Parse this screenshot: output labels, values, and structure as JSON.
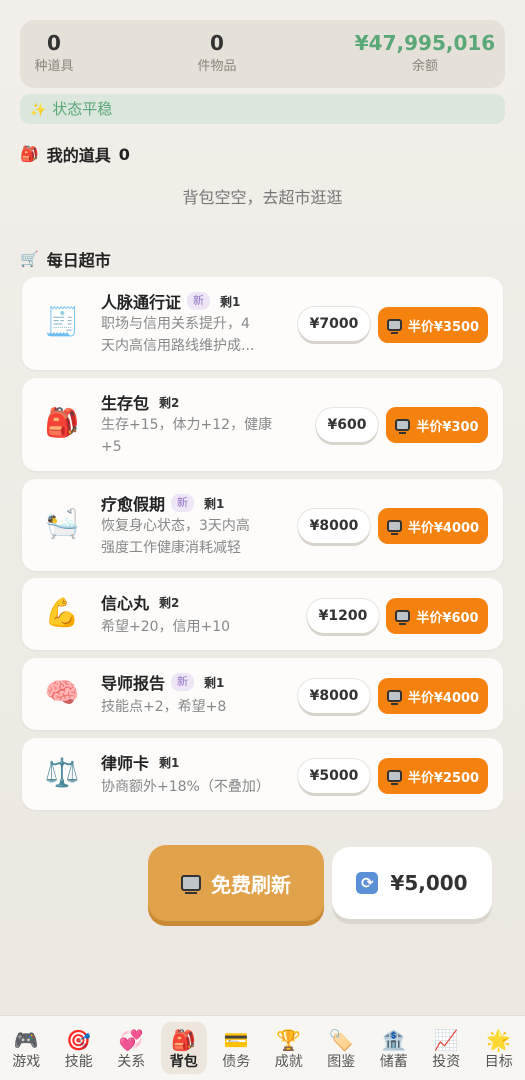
{
  "stats": [
    {
      "value": "0",
      "label": "种道具"
    },
    {
      "value": "0",
      "label": "件物品"
    },
    {
      "value": "¥47,995,016",
      "label": "余额"
    }
  ],
  "status": {
    "icon": "sparkle-icon",
    "text": "状态平稳"
  },
  "inventory": {
    "icon": "backpack-icon",
    "title": "我的道具",
    "count": "0",
    "empty_text": "背包空空，去超市逛逛"
  },
  "shop": {
    "icon": "cart-icon",
    "title": "每日超市",
    "items": [
      {
        "emoji": "🧾",
        "icon": "receipt-icon",
        "name": "人脉通行证",
        "is_new": true,
        "new_label": "新",
        "stock": "剩1",
        "desc": [
          "职场与信用关系提升，4",
          "天内高信用路线维护成..."
        ],
        "price": "¥7000",
        "half_label": "半价¥3500"
      },
      {
        "emoji": "🎒",
        "icon": "backpack-icon",
        "name": "生存包",
        "is_new": false,
        "new_label": "",
        "stock": "剩2",
        "desc": [
          "生存+15，体力+12，健康",
          "+5"
        ],
        "price": "¥600",
        "half_label": "半价¥300"
      },
      {
        "emoji": "🛀",
        "icon": "bathtub-icon",
        "name": "疗愈假期",
        "is_new": true,
        "new_label": "新",
        "stock": "剩1",
        "desc": [
          "恢复身心状态，3天内高",
          "强度工作健康消耗减轻"
        ],
        "price": "¥8000",
        "half_label": "半价¥4000"
      },
      {
        "emoji": "💪",
        "icon": "flexed-biceps-icon",
        "name": "信心丸",
        "is_new": false,
        "new_label": "",
        "stock": "剩2",
        "desc": [
          "希望+20，信用+10"
        ],
        "price": "¥1200",
        "half_label": "半价¥600"
      },
      {
        "emoji": "🧠",
        "icon": "brain-icon",
        "name": "导师报告",
        "is_new": true,
        "new_label": "新",
        "stock": "剩1",
        "desc": [
          "技能点+2，希望+8"
        ],
        "price": "¥8000",
        "half_label": "半价¥4000"
      },
      {
        "emoji": "⚖️",
        "icon": "scales-icon",
        "name": "律师卡",
        "is_new": false,
        "new_label": "",
        "stock": "剩1",
        "desc": [
          "协商额外+18%（不叠加）"
        ],
        "price": "¥5000",
        "half_label": "半价¥2500"
      }
    ]
  },
  "refresh": {
    "free_label": "免费刷新",
    "paid_label": "¥5,000"
  },
  "tabs": [
    {
      "emoji": "🎮",
      "icon": "gamepad-icon",
      "label": "游戏"
    },
    {
      "emoji": "🎯",
      "icon": "target-icon",
      "label": "技能"
    },
    {
      "emoji": "💞",
      "icon": "hearts-icon",
      "label": "关系"
    },
    {
      "emoji": "🎒",
      "icon": "backpack-icon",
      "label": "背包",
      "active": true
    },
    {
      "emoji": "💳",
      "icon": "credit-card-icon",
      "label": "债务"
    },
    {
      "emoji": "🏆",
      "icon": "trophy-icon",
      "label": "成就"
    },
    {
      "emoji": "🏷️",
      "icon": "tag-icon",
      "label": "图鉴"
    },
    {
      "emoji": "🏦",
      "icon": "bank-icon",
      "label": "储蓄"
    },
    {
      "emoji": "📈",
      "icon": "chart-up-icon",
      "label": "投资"
    },
    {
      "emoji": "🌟",
      "icon": "star-icon",
      "label": "目标"
    }
  ]
}
